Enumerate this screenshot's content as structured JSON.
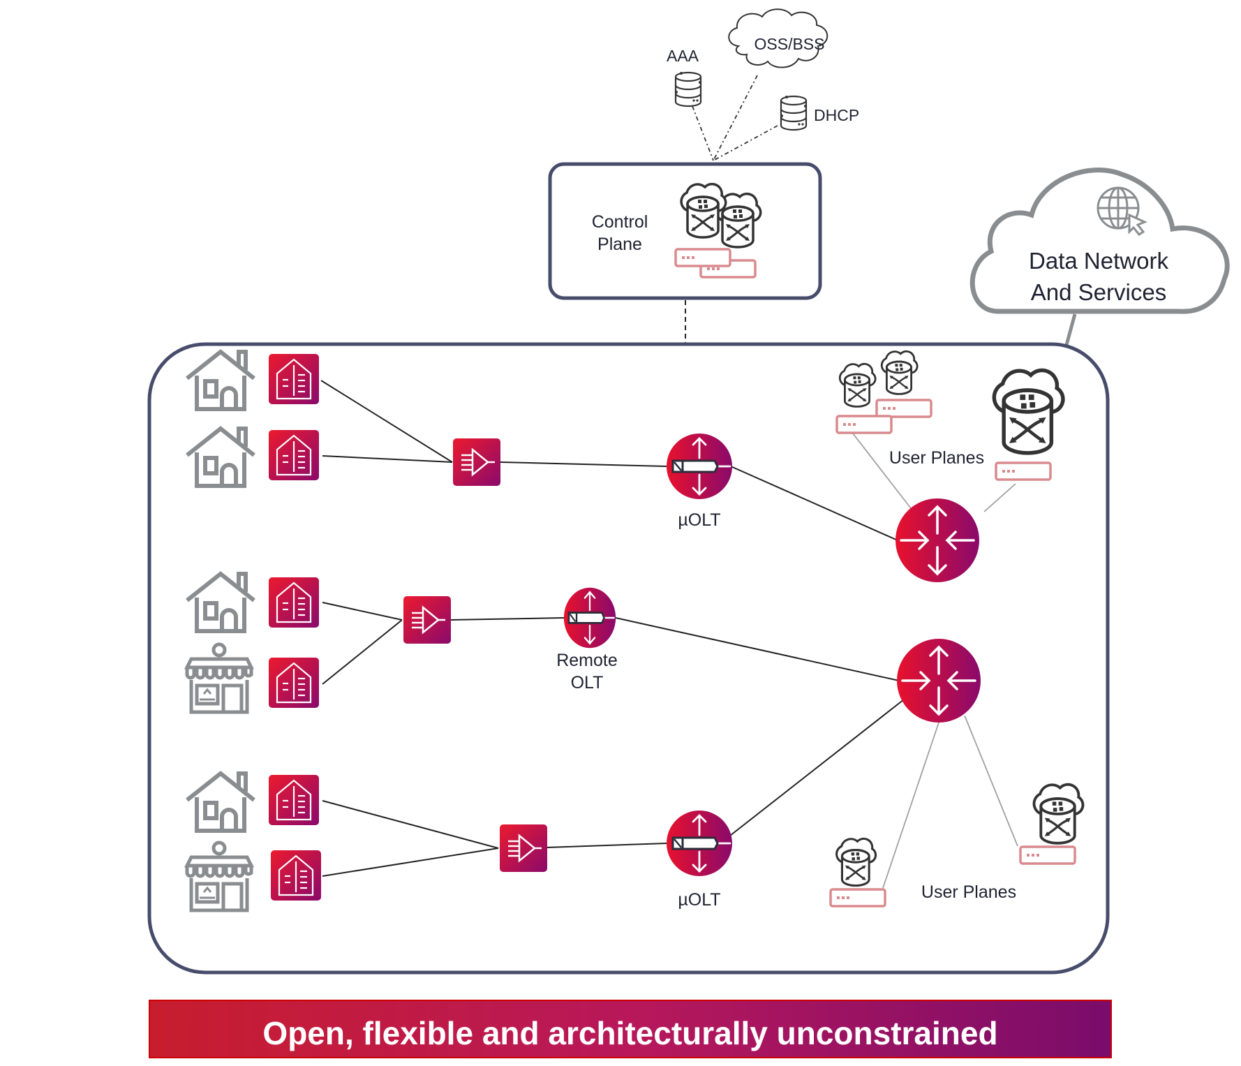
{
  "top_services": {
    "aaa_label": "AAA",
    "oss_bss_label": "OSS/BSS",
    "dhcp_label": "DHCP"
  },
  "control_plane": {
    "label_line1": "Control",
    "label_line2": "Plane"
  },
  "data_network": {
    "label_line1": "Data Network",
    "label_line2": "And Services",
    "icon": "globe-cursor-icon"
  },
  "access_network": {
    "olt_top": {
      "label": "µOLT"
    },
    "olt_remote": {
      "label_line1": "Remote",
      "label_line2": "OLT"
    },
    "olt_bottom": {
      "label": "µOLT"
    },
    "user_planes_top": {
      "label": "User Planes"
    },
    "user_planes_bottom": {
      "label": "User Planes"
    },
    "premises": [
      {
        "type": "house",
        "icon": "house-icon"
      },
      {
        "type": "house",
        "icon": "house-icon"
      },
      {
        "type": "house",
        "icon": "house-icon"
      },
      {
        "type": "shop",
        "icon": "shop-icon"
      },
      {
        "type": "house",
        "icon": "house-icon"
      },
      {
        "type": "shop",
        "icon": "shop-icon"
      }
    ]
  },
  "banner": {
    "text": "Open, flexible and architecturally unconstrained"
  },
  "colors": {
    "gradient_start": "#e8112d",
    "gradient_end": "#8a0a6b",
    "frame": "#474c6b",
    "server_outline": "#d98a8e",
    "icon_gray": "#8a8d90",
    "cloud_gray": "#8a8d90"
  }
}
